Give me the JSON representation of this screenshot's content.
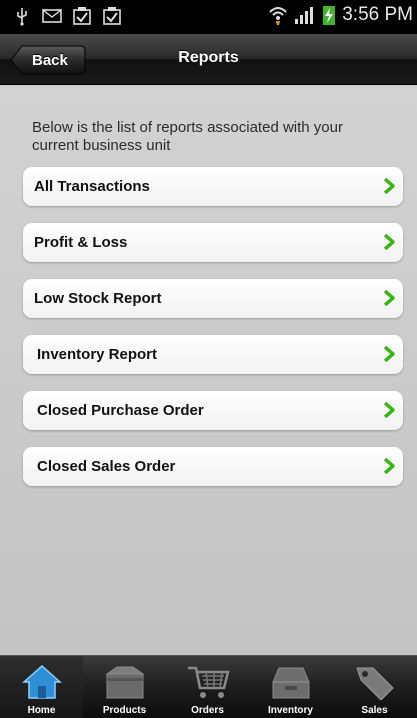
{
  "status_bar": {
    "time": "3:56 PM",
    "left_icons": [
      "usb-icon",
      "mail-icon",
      "task-check-icon",
      "task-check-icon"
    ],
    "right_icons": [
      "wifi-icon",
      "signal-icon",
      "battery-charging-icon"
    ]
  },
  "header": {
    "title": "Reports",
    "back_label": "Back"
  },
  "intro_text": "Below is the list of reports associated with your current business unit",
  "reports": [
    {
      "label": "All Transactions"
    },
    {
      "label": "Profit & Loss"
    },
    {
      "label": "Low Stock Report"
    },
    {
      "label": "Inventory Report"
    },
    {
      "label": "Closed Purchase Order"
    },
    {
      "label": "Closed Sales Order"
    }
  ],
  "tabs": [
    {
      "label": "Home",
      "icon": "home-icon",
      "active": true
    },
    {
      "label": "Products",
      "icon": "box-icon",
      "active": false
    },
    {
      "label": "Orders",
      "icon": "cart-icon",
      "active": false
    },
    {
      "label": "Inventory",
      "icon": "drawer-icon",
      "active": false
    },
    {
      "label": "Sales",
      "icon": "tag-icon",
      "active": false
    }
  ],
  "colors": {
    "chevron": "#3db318",
    "home_icon": "#2f8fd6"
  }
}
